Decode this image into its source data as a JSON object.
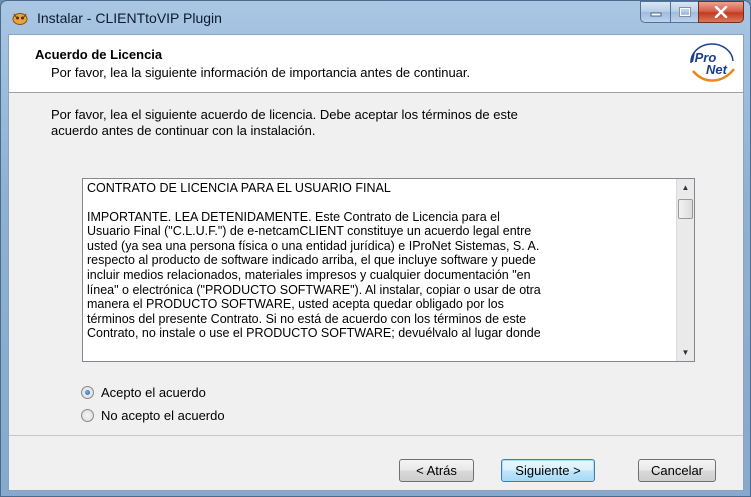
{
  "window": {
    "title": "Instalar - CLIENTtoVIP Plugin"
  },
  "header": {
    "title": "Acuerdo de Licencia",
    "subtitle": "Por favor, lea la siguiente información de importancia antes de continuar.",
    "logo_text_top": "IPro",
    "logo_text_bottom": "Net"
  },
  "intro": {
    "line1": "Por favor, lea el siguiente acuerdo de licencia. Debe aceptar los términos de este",
    "line2": "acuerdo antes de continuar con la instalación."
  },
  "license": {
    "heading": "CONTRATO DE LICENCIA PARA EL USUARIO FINAL",
    "lines": [
      "IMPORTANTE. LEA DETENIDAMENTE. Este Contrato de Licencia para el",
      "Usuario Final (\"C.L.U.F.\") de e-netcamCLIENT constituye un acuerdo legal entre",
      "usted (ya sea una persona física o una entidad jurídica) e IProNet Sistemas, S. A.",
      "respecto al producto de software indicado arriba, el que incluye software y puede",
      "incluir medios relacionados, materiales impresos y cualquier documentación \"en",
      "línea\" o electrónica (\"PRODUCTO SOFTWARE\"). Al instalar, copiar o usar de otra",
      "manera el PRODUCTO SOFTWARE, usted acepta quedar obligado por los",
      "términos del presente Contrato. Si no está de acuerdo con los términos de este",
      "Contrato, no instale o use el PRODUCTO SOFTWARE; devuélvalo al lugar donde"
    ]
  },
  "options": {
    "accept": "Acepto el acuerdo",
    "decline": "No acepto el acuerdo",
    "selected": "accept"
  },
  "buttons": {
    "back": "< Atrás",
    "next": "Siguiente >",
    "cancel": "Cancelar"
  },
  "colors": {
    "titlebar": "#a9c6e3",
    "close_button": "#c23b22",
    "logo_blue": "#1b3f8f",
    "logo_orange": "#e8891d"
  }
}
